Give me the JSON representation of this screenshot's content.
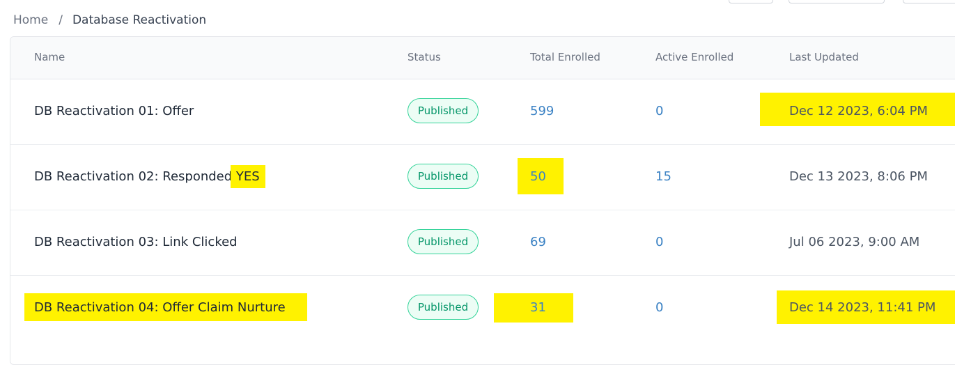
{
  "breadcrumb": {
    "home": "Home",
    "separator": "/",
    "current": "Database Reactivation"
  },
  "table": {
    "headers": {
      "name": "Name",
      "status": "Status",
      "total": "Total Enrolled",
      "active": "Active Enrolled",
      "updated": "Last Updated"
    },
    "rows": [
      {
        "name": "DB Reactivation 01: Offer",
        "status": "Published",
        "total": "599",
        "active": "0",
        "updated": "Dec 12 2023, 6:04 PM"
      },
      {
        "name_prefix": "DB Reactivation 02: Responded ",
        "name_highlight": "YES",
        "status": "Published",
        "total": "50",
        "active": "15",
        "updated": "Dec 13 2023, 8:06 PM"
      },
      {
        "name": "DB Reactivation 03: Link Clicked",
        "status": "Published",
        "total": "69",
        "active": "0",
        "updated": "Jul 06 2023, 9:00 AM"
      },
      {
        "name": "DB Reactivation 04: Offer Claim Nurture",
        "status": "Published",
        "total": "31",
        "active": "0",
        "updated": "Dec 14 2023, 11:41 PM"
      }
    ]
  },
  "colors": {
    "highlight": "#fff200",
    "badge_green": "#059669",
    "link_blue": "#3b82c4"
  }
}
